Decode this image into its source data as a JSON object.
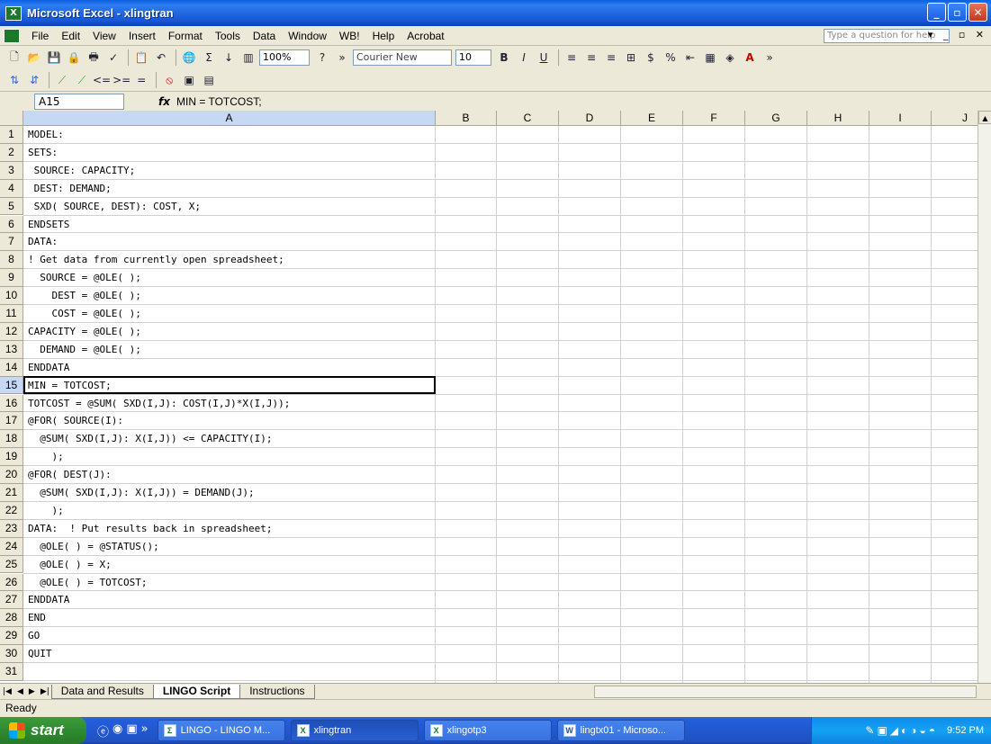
{
  "window": {
    "title": "Microsoft Excel - xlingtran"
  },
  "menu": {
    "items": [
      "File",
      "Edit",
      "View",
      "Insert",
      "Format",
      "Tools",
      "Data",
      "Window",
      "WB!",
      "Help",
      "Acrobat"
    ],
    "help_placeholder": "Type a question for help"
  },
  "toolbar": {
    "zoom": "100%",
    "font": "Courier New",
    "size": "10"
  },
  "formula": {
    "cell_ref": "A15",
    "content": "MIN = TOTCOST;"
  },
  "columns": [
    "A",
    "B",
    "C",
    "D",
    "E",
    "F",
    "G",
    "H",
    "I",
    "J"
  ],
  "active_cell": {
    "col": "A",
    "row": 15
  },
  "rows": [
    {
      "n": "1",
      "text": "MODEL:"
    },
    {
      "n": "2",
      "text": "SETS:"
    },
    {
      "n": "3",
      "text": " SOURCE: CAPACITY;"
    },
    {
      "n": "4",
      "text": " DEST: DEMAND;"
    },
    {
      "n": "5",
      "text": " SXD( SOURCE, DEST): COST, X;"
    },
    {
      "n": "6",
      "text": "ENDSETS"
    },
    {
      "n": "7",
      "text": "DATA:"
    },
    {
      "n": "8",
      "text": "! Get data from currently open spreadsheet;"
    },
    {
      "n": "9",
      "text": "  SOURCE = @OLE( );"
    },
    {
      "n": "10",
      "text": "    DEST = @OLE( );"
    },
    {
      "n": "11",
      "text": "    COST = @OLE( );"
    },
    {
      "n": "12",
      "text": "CAPACITY = @OLE( );"
    },
    {
      "n": "13",
      "text": "  DEMAND = @OLE( );"
    },
    {
      "n": "14",
      "text": "ENDDATA"
    },
    {
      "n": "15",
      "text": "MIN = TOTCOST;"
    },
    {
      "n": "16",
      "text": "TOTCOST = @SUM( SXD(I,J): COST(I,J)*X(I,J));"
    },
    {
      "n": "17",
      "text": "@FOR( SOURCE(I):"
    },
    {
      "n": "18",
      "text": "  @SUM( SXD(I,J): X(I,J)) <= CAPACITY(I);"
    },
    {
      "n": "19",
      "text": "    );"
    },
    {
      "n": "20",
      "text": "@FOR( DEST(J):"
    },
    {
      "n": "21",
      "text": "  @SUM( SXD(I,J): X(I,J)) = DEMAND(J);"
    },
    {
      "n": "22",
      "text": "    );"
    },
    {
      "n": "23",
      "text": "DATA:  ! Put results back in spreadsheet;"
    },
    {
      "n": "24",
      "text": "  @OLE( ) = @STATUS();"
    },
    {
      "n": "25",
      "text": "  @OLE( ) = X;"
    },
    {
      "n": "26",
      "text": "  @OLE( ) = TOTCOST;"
    },
    {
      "n": "27",
      "text": "ENDDATA"
    },
    {
      "n": "28",
      "text": "END"
    },
    {
      "n": "29",
      "text": "GO"
    },
    {
      "n": "30",
      "text": "QUIT"
    },
    {
      "n": "31",
      "text": ""
    }
  ],
  "sheets": [
    "Data and Results",
    "LINGO Script",
    "Instructions"
  ],
  "active_sheet": "LINGO Script",
  "status": "Ready",
  "taskbar": {
    "start": "start",
    "buttons": [
      "LINGO - LINGO M...",
      "xlingtran",
      "xlingotp3",
      "lingtx01 - Microso..."
    ],
    "clock": "9:52 PM"
  },
  "colors": {
    "title_blue": "#0a5fe0",
    "selection_blue": "#c6d8f4",
    "start_green": "#2f8a2f"
  }
}
